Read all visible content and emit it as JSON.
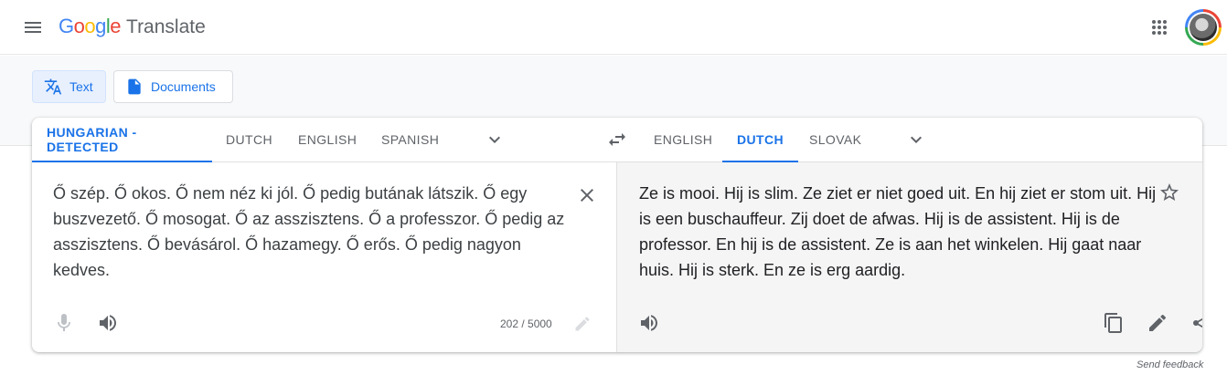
{
  "header": {
    "logo_letters": [
      "G",
      "o",
      "o",
      "g",
      "l",
      "e"
    ],
    "logo_colors": [
      "#4285F4",
      "#EA4335",
      "#FBBC05",
      "#4285F4",
      "#34A853",
      "#EA4335"
    ],
    "product": "Translate"
  },
  "modes": {
    "text_label": "Text",
    "documents_label": "Documents"
  },
  "source": {
    "tabs": [
      "HUNGARIAN - DETECTED",
      "DUTCH",
      "ENGLISH",
      "SPANISH"
    ],
    "active_tab": 0,
    "text": "Ő szép. Ő okos. Ő nem néz ki jól. Ő pedig butának látszik. Ő egy buszvezető. Ő mosogat. Ő az asszisztens. Ő a professzor. Ő pedig az asszisztens. Ő bevásárol. Ő hazamegy. Ő erős. Ő pedig nagyon kedves.",
    "char_count": "202 / 5000"
  },
  "target": {
    "tabs": [
      "ENGLISH",
      "DUTCH",
      "SLOVAK"
    ],
    "active_tab": 1,
    "text": "Ze is mooi. Hij is slim. Ze ziet er niet goed uit. En hij ziet er stom uit. Hij is een buschauffeur. Zij doet de afwas. Hij is de assistent. Hij is de professor. En hij is de assistent. Ze is aan het winkelen. Hij gaat naar huis. Hij is sterk. En ze is erg aardig."
  },
  "footer": {
    "feedback": "Send feedback"
  },
  "colors": {
    "accent": "#1a73e8",
    "icon": "#5f6368"
  },
  "icons": [
    "menu-icon",
    "apps-icon",
    "translate-icon",
    "document-icon",
    "chevron-down-icon",
    "swap-icon",
    "close-icon",
    "microphone-icon",
    "speaker-icon",
    "pencil-icon",
    "star-icon",
    "copy-icon",
    "share-icon"
  ]
}
